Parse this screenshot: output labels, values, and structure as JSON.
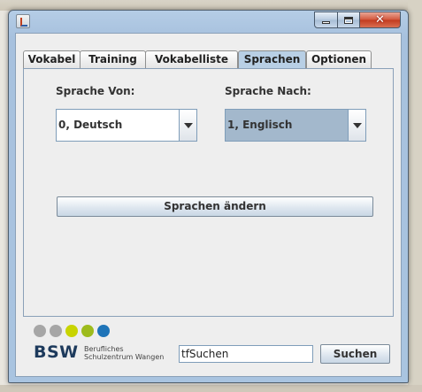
{
  "window": {
    "title": ""
  },
  "tabs": [
    {
      "label": "Vokabel"
    },
    {
      "label": "Training"
    },
    {
      "label": "Vokabelliste"
    },
    {
      "label": "Sprachen"
    },
    {
      "label": "Optionen"
    }
  ],
  "active_tab": "Sprachen",
  "language": {
    "from_label": "Sprache Von:",
    "to_label": "Sprache Nach:",
    "from_value": "0, Deutsch",
    "to_value": "1, Englisch",
    "change_button": "Sprachen ändern"
  },
  "logo": {
    "text": "BSW",
    "line1": "Berufliches",
    "line2": "Schulzentrum Wangen",
    "dot_colors": [
      "#a6a6a6",
      "#a6a6a6",
      "#c8d400",
      "#9dbb1c",
      "#1f74b8"
    ]
  },
  "search": {
    "value": "tfSuchen",
    "button": "Suchen"
  },
  "colors": {
    "active_tab": "#b8cfe5",
    "selected_combo": "#a3b8cc",
    "close_button": "#c23a1e"
  }
}
